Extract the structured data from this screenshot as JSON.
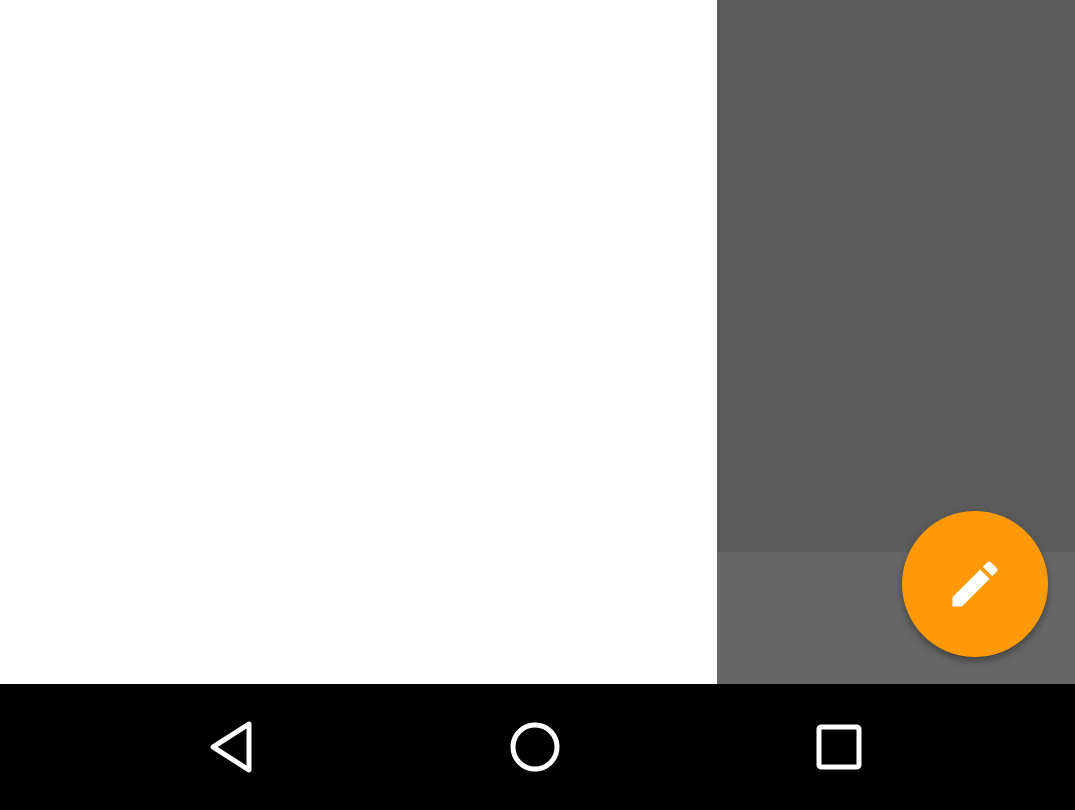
{
  "drawer": {
    "background": "#ffffff"
  },
  "scrim": {
    "color_top": "#5b5b5b",
    "color_bottom": "#666666"
  },
  "fab": {
    "icon": "pencil-icon",
    "color": "#ff9a06"
  },
  "navbar": {
    "buttons": [
      {
        "icon": "back-triangle-icon"
      },
      {
        "icon": "home-circle-icon"
      },
      {
        "icon": "recents-square-icon"
      }
    ]
  }
}
